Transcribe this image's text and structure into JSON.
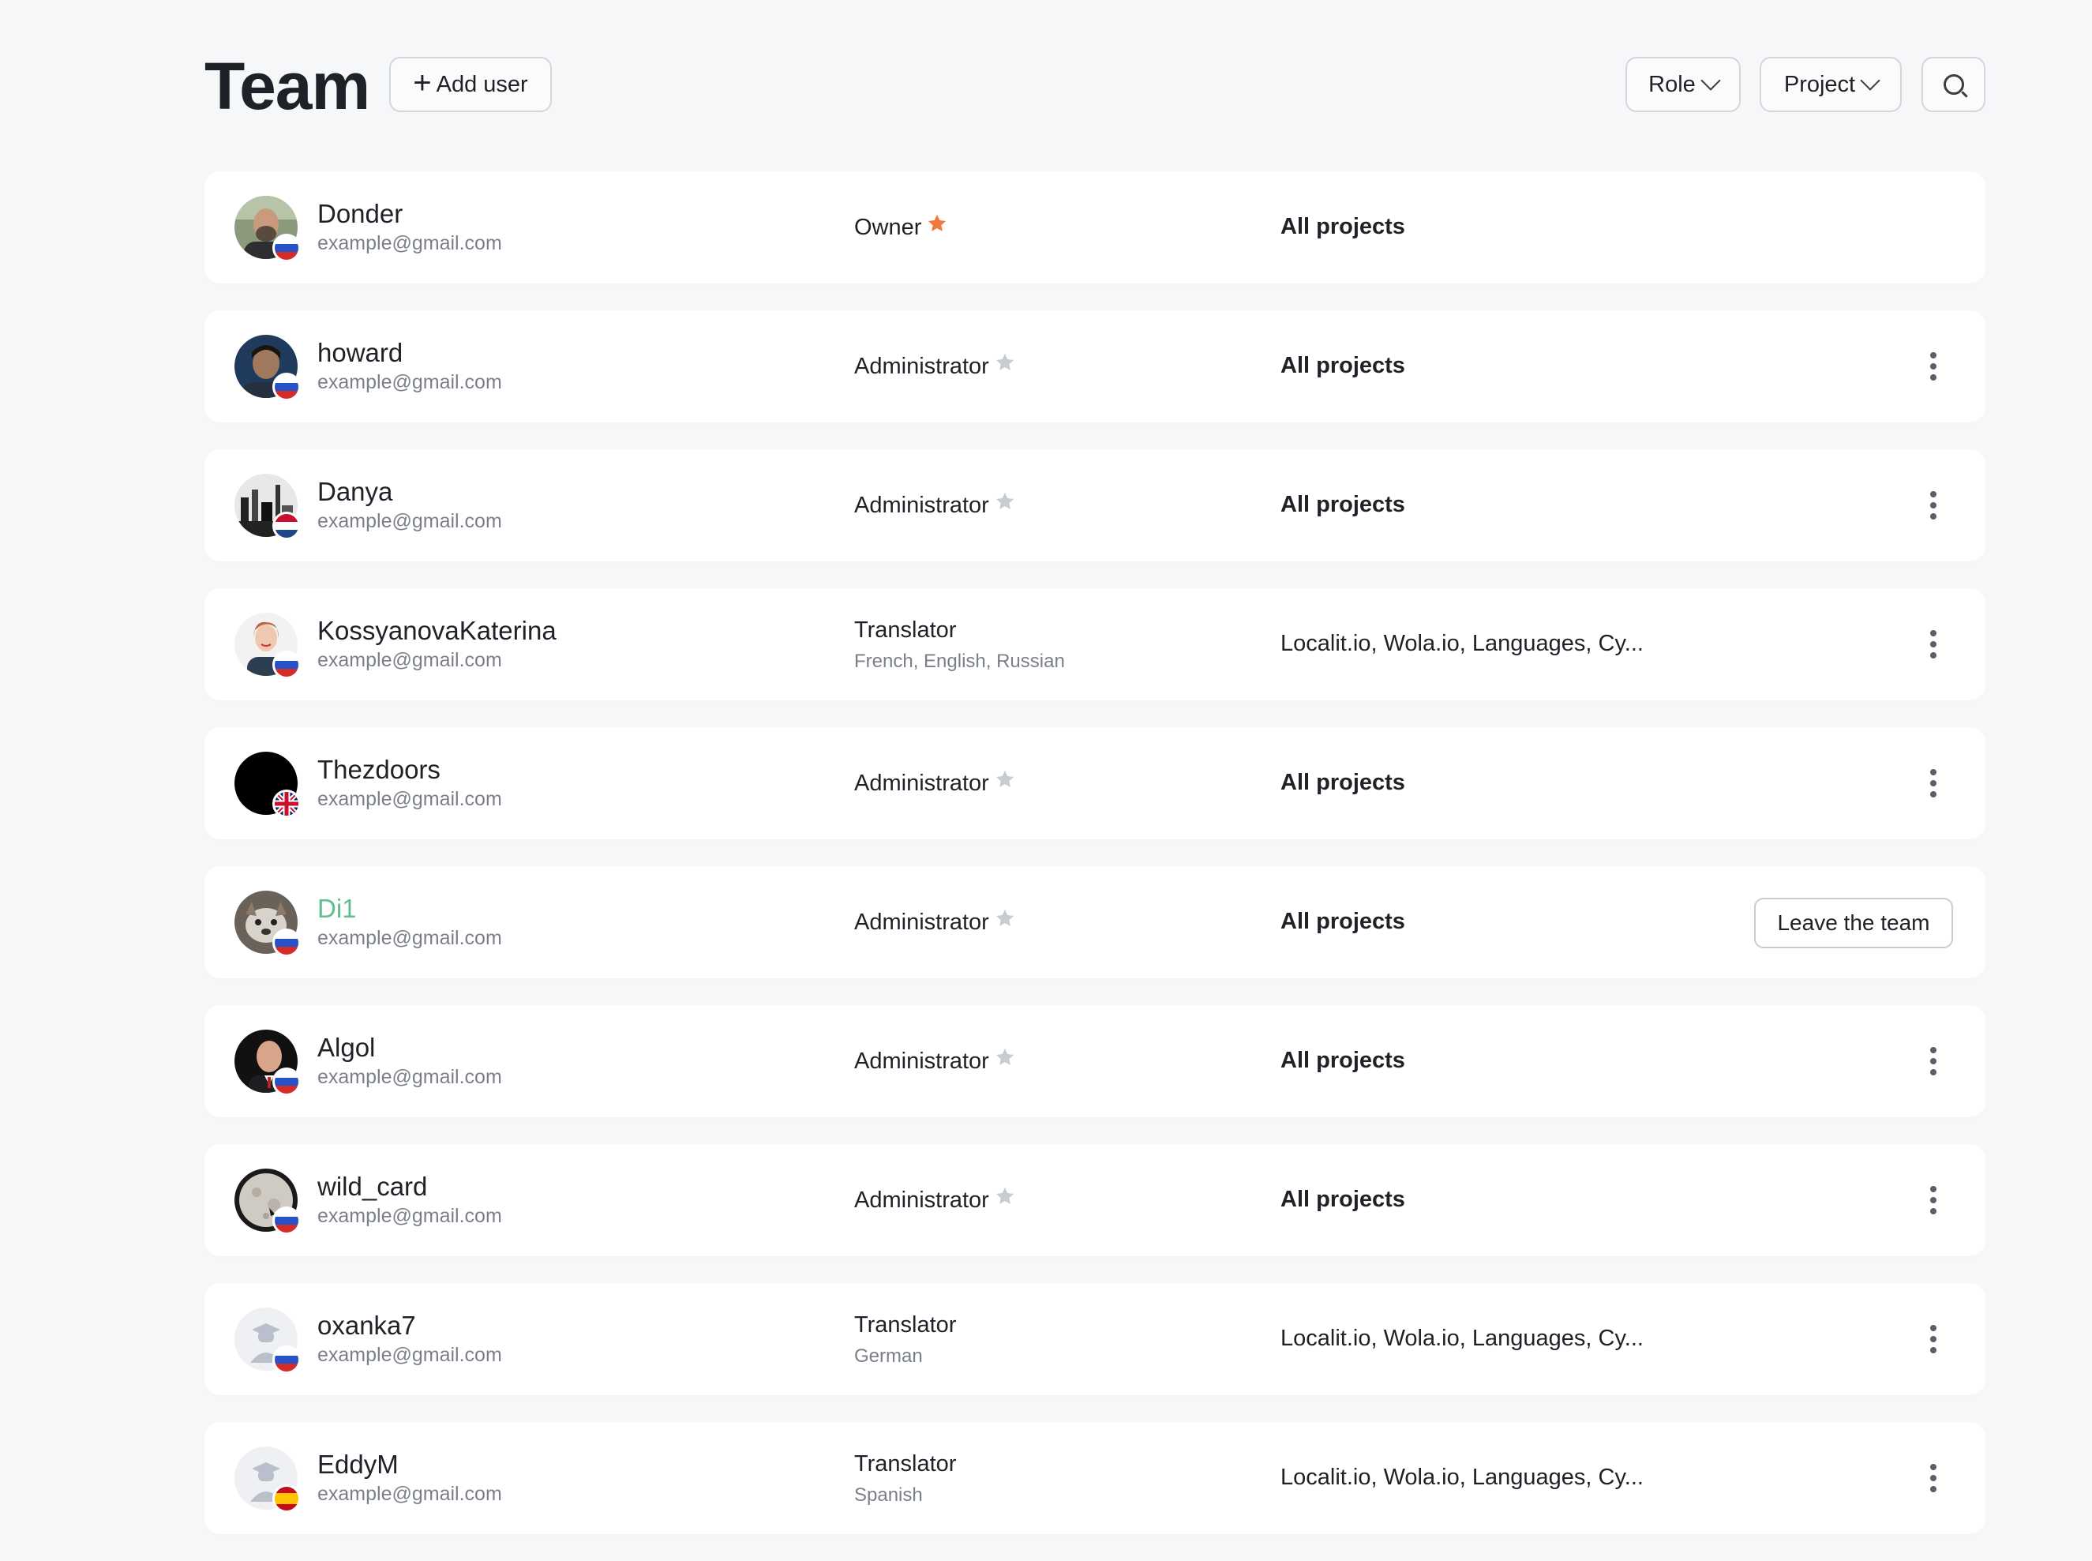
{
  "header": {
    "title": "Team",
    "add_user_label": "Add user",
    "role_filter_label": "Role",
    "project_filter_label": "Project"
  },
  "colors": {
    "owner_star": "#f07a3c",
    "admin_star": "#c8cbd1",
    "online_name": "#5fbf8f"
  },
  "members": [
    {
      "name": "Donder",
      "email": "example@gmail.com",
      "role": "Owner",
      "star": "owner",
      "languages": "",
      "projects": "All projects",
      "projects_bold": true,
      "action": "none",
      "flag": "ru",
      "avatar": "photo-man-beard"
    },
    {
      "name": "howard",
      "email": "example@gmail.com",
      "role": "Administrator",
      "star": "admin",
      "languages": "",
      "projects": "All projects",
      "projects_bold": true,
      "action": "menu",
      "flag": "ru",
      "avatar": "photo-man-dark"
    },
    {
      "name": "Danya",
      "email": "example@gmail.com",
      "role": "Administrator",
      "star": "admin",
      "languages": "",
      "projects": "All projects",
      "projects_bold": true,
      "action": "menu",
      "flag": "nl",
      "avatar": "photo-bw-city"
    },
    {
      "name": "KossyanovaKaterina",
      "email": "example@gmail.com",
      "role": "Translator",
      "star": "none",
      "languages": "French, English, Russian",
      "projects": "Localit.io, Wola.io, Languages, Cy...",
      "projects_bold": false,
      "action": "menu",
      "flag": "ru",
      "avatar": "photo-woman"
    },
    {
      "name": "Thezdoors",
      "email": "example@gmail.com",
      "role": "Administrator",
      "star": "admin",
      "languages": "",
      "projects": "All projects",
      "projects_bold": true,
      "action": "menu",
      "flag": "gb",
      "avatar": "black-circle"
    },
    {
      "name": "Di1",
      "email": "example@gmail.com",
      "role": "Administrator",
      "star": "admin",
      "languages": "",
      "projects": "All projects",
      "projects_bold": true,
      "action": "leave",
      "action_label": "Leave the team",
      "flag": "ru",
      "avatar": "photo-dog",
      "name_green": true
    },
    {
      "name": "Algol",
      "email": "example@gmail.com",
      "role": "Administrator",
      "star": "admin",
      "languages": "",
      "projects": "All projects",
      "projects_bold": true,
      "action": "menu",
      "flag": "ru",
      "avatar": "photo-man-bald"
    },
    {
      "name": "wild_card",
      "email": "example@gmail.com",
      "role": "Administrator",
      "star": "admin",
      "languages": "",
      "projects": "All projects",
      "projects_bold": true,
      "action": "menu",
      "flag": "ru",
      "avatar": "photo-moon"
    },
    {
      "name": "oxanka7",
      "email": "example@gmail.com",
      "role": "Translator",
      "star": "none",
      "languages": "German",
      "projects": "Localit.io, Wola.io, Languages, Cy...",
      "projects_bold": false,
      "action": "menu",
      "flag": "ru",
      "avatar": "placeholder-graduate"
    },
    {
      "name": "EddyM",
      "email": "example@gmail.com",
      "role": "Translator",
      "star": "none",
      "languages": "Spanish",
      "projects": "Localit.io, Wola.io, Languages, Cy...",
      "projects_bold": false,
      "action": "menu",
      "flag": "es",
      "avatar": "placeholder-graduate"
    }
  ]
}
